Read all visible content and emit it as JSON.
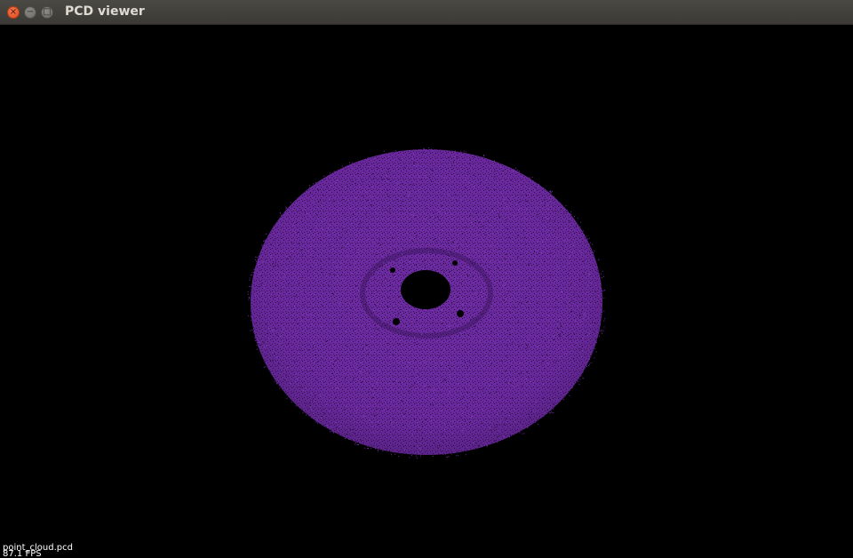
{
  "window": {
    "title": "PCD viewer",
    "buttons": {
      "close_glyph": "×",
      "minimize_glyph": "−",
      "maximize_glyph": "□"
    }
  },
  "viewer": {
    "background": "#000000",
    "point_color": "#6a2a9c",
    "overlay": {
      "filename": "point_cloud.pcd",
      "fps": "87.1 FPS"
    }
  }
}
